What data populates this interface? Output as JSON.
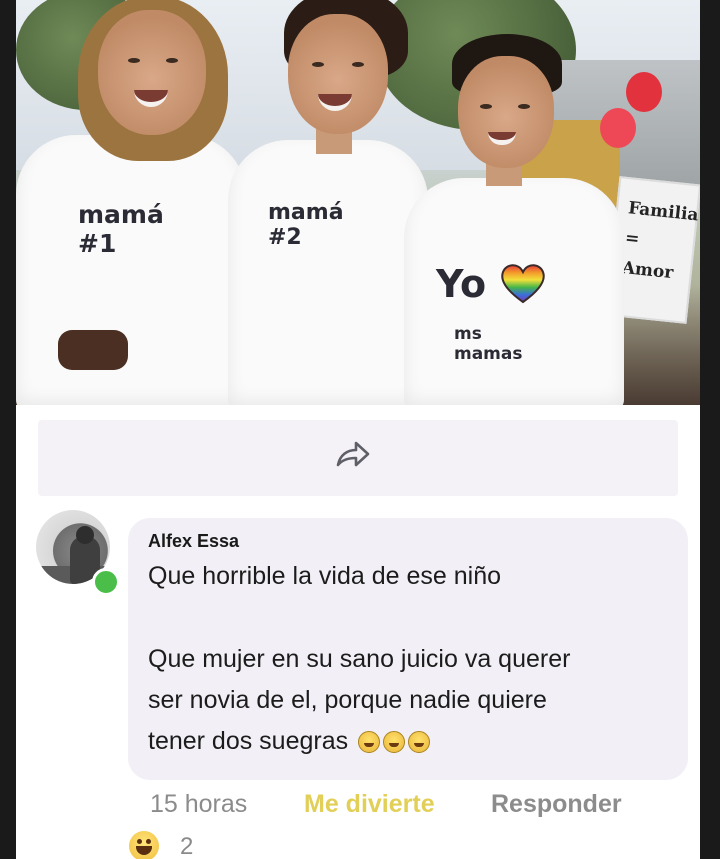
{
  "post": {
    "photo": {
      "shirt_left": "mamá #1",
      "shirt_middle": "mamá #2",
      "shirt_right_big": "Yo",
      "shirt_right_small": "ms mamas",
      "sign_line1": "Familia",
      "sign_line2": "=",
      "sign_line3": "Amor"
    },
    "share_icon": "share-arrow-icon"
  },
  "comment": {
    "author": "Alfex Essa",
    "lines": [
      "Que horrible la vida de ese niño",
      "Que mujer en su sano juicio va querer",
      "ser novia de el, porque nadie quiere",
      "tener dos suegras"
    ],
    "emoji_icon": "laughing-emoji-icon",
    "online": true
  },
  "actions": {
    "time": "15 horas",
    "react": "Me divierte",
    "reply": "Responder"
  },
  "reactions": {
    "icon": "haha-reaction-icon",
    "count": "2"
  },
  "colors": {
    "online_dot": "#4bbe4a",
    "react_active": "#e2cf57",
    "bubble": "#f2f0f6"
  }
}
